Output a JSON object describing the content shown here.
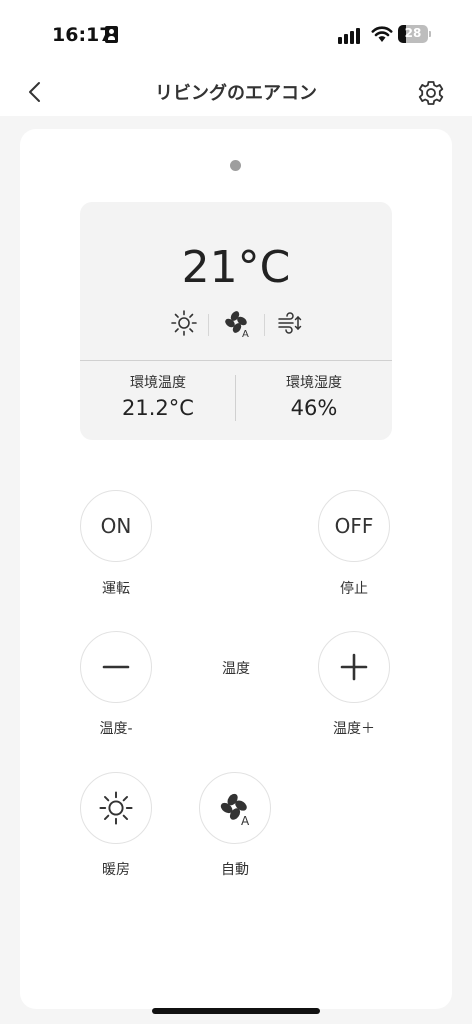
{
  "status_bar": {
    "time": "16:17",
    "battery": "28",
    "battery_level": 0.28
  },
  "header": {
    "title": "リビングのエアコン"
  },
  "card": {
    "temperature": "21°C",
    "mode_icons": [
      "sun-icon",
      "fan-auto-icon",
      "wind-swing-icon"
    ],
    "stats": [
      {
        "label": "環境温度",
        "value": "21.2°C"
      },
      {
        "label": "環境湿度",
        "value": "46%"
      }
    ]
  },
  "controls": {
    "on_button": "ON",
    "on_label": "運転",
    "off_button": "OFF",
    "off_label": "停止",
    "temp_center_label": "温度",
    "temp_down_label": "温度-",
    "temp_up_label": "温度＋",
    "heat_label": "暖房",
    "auto_label": "自動"
  }
}
